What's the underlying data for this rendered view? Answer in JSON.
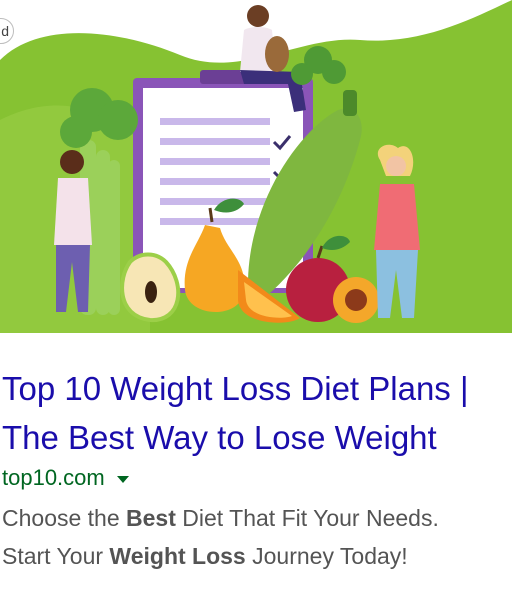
{
  "ad": {
    "badge_text": "d",
    "image": {
      "description_icon": "diet-plan-illustration"
    },
    "title_line1": "Top 10 Weight Loss Diet Plans |",
    "title_line2": "The Best Way to Lose Weight",
    "display_url": "top10.com",
    "url_menu_icon": "dropdown-caret-icon",
    "description": {
      "line1_a": "Choose the ",
      "line1_bold": "Best",
      "line1_b": " Diet That Fit Your Needs.",
      "line2_a": "Start Your ",
      "line2_bold": "Weight Loss",
      "line2_b": " Journey Today!"
    }
  },
  "colors": {
    "title_link": "#1a0dab",
    "url_green": "#006621",
    "description_gray": "#545454",
    "leaf_green": "#86c232"
  }
}
